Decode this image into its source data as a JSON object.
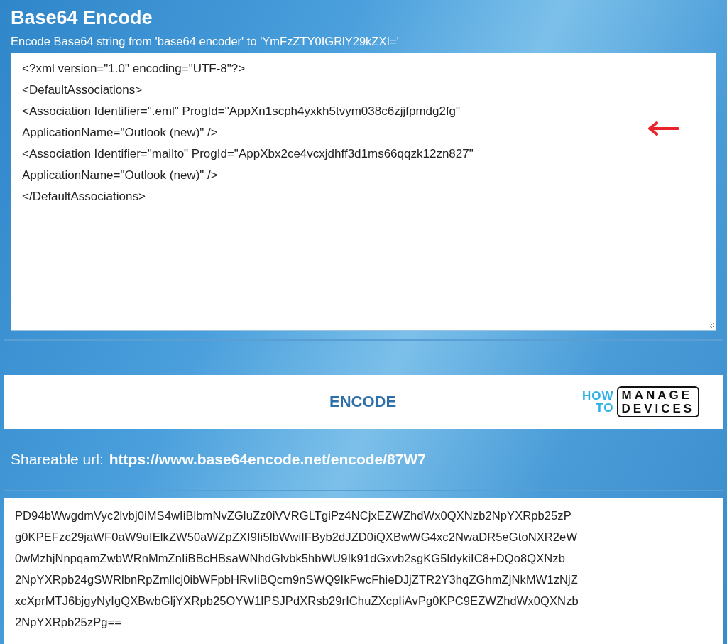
{
  "title": "Base64 Encode",
  "subtitle": "Encode Base64 string from 'base64 encoder' to 'YmFzZTY0IGRlY29kZXI='",
  "input": {
    "lines": [
      "<?xml version=\"1.0\" encoding=\"UTF-8\"?>",
      "<DefaultAssociations>",
      "<Association Identifier=\".eml\" ProgId=\"AppXn1scph4yxkh5tvym038c6zjjfpmdg2fg\"",
      "ApplicationName=\"Outlook (new)\" />",
      "<Association Identifier=\"mailto\" ProgId=\"AppXbx2ce4vcxjdhff3d1ms66qqzk12zn827\"",
      "ApplicationName=\"Outlook (new)\" />",
      "</DefaultAssociations>"
    ]
  },
  "encode_button": "ENCODE",
  "logo": {
    "how": "HOW",
    "to": "TO",
    "manage": "MANAGE",
    "devices": "DEVICES"
  },
  "share": {
    "label": "Shareable url:",
    "url": "https://www.base64encode.net/encode/87W7"
  },
  "output": {
    "lines": [
      "PD94bWwgdmVyc2lvbj0iMS4wIiBlbmNvZGluZz0iVVRGLTgiPz4NCjxEZWZhdWx0QXNzb2NpYXRpb25zP",
      "g0KPEFzc29jaWF0aW9uIElkZW50aWZpZXI9Ii5lbWwiIFByb2dJZD0iQXBwWG4xc2NwaDR5eGtoNXR2eW",
      "0wMzhjNnpqamZwbWRnMmZnIiBBcHBsaWNhdGlvbk5hbWU9Ik91dGxvb2sgKG5ldykiIC8+DQo8QXNzb",
      "2NpYXRpb24gSWRlbnRpZmllcj0ibWFpbHRvIiBQcm9nSWQ9IkFwcFhieDJjZTR2Y3hqZGhmZjNkMW1zNjZ",
      "xcXprMTJ6bjgyNyIgQXBwbGljYXRpb25OYW1lPSJPdXRsb29rIChuZXcpIiAvPg0KPC9EZWZhdWx0QXNzb",
      "2NpYXRpb25zPg=="
    ]
  }
}
